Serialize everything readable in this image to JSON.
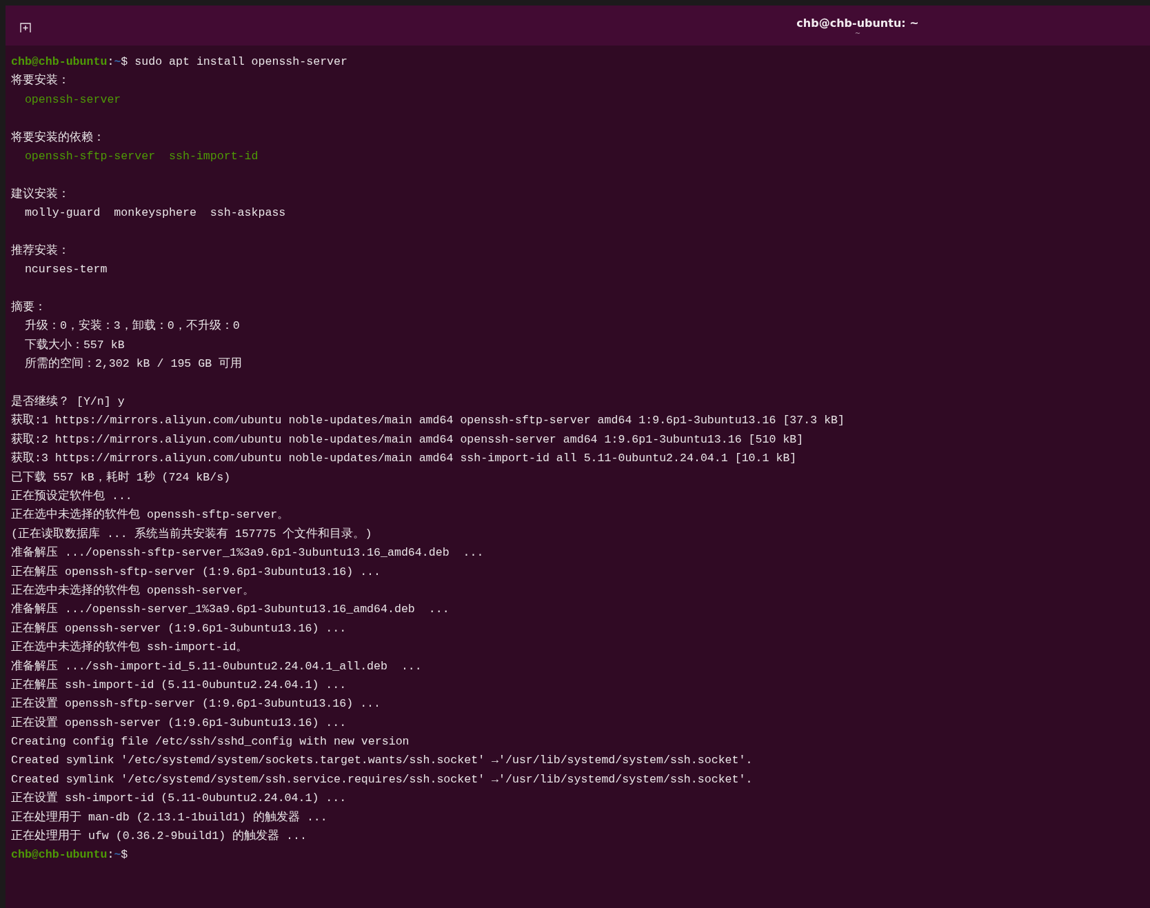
{
  "window": {
    "title": "chb@chb-ubuntu: ~",
    "subtitle": "~"
  },
  "lines": [
    {
      "kind": "text",
      "segments": [
        {
          "kind": "user",
          "text": "chb@chb-ubuntu"
        },
        {
          "kind": "plain",
          "text": ":"
        },
        {
          "kind": "path",
          "text": "~"
        },
        {
          "kind": "plain",
          "text": "$ sudo apt install openssh-server"
        }
      ]
    },
    {
      "kind": "text",
      "segments": [
        {
          "kind": "plain",
          "text": "将要安装："
        }
      ]
    },
    {
      "kind": "text",
      "segments": [
        {
          "kind": "package",
          "text": "  openssh-server"
        }
      ]
    },
    {
      "kind": "blank"
    },
    {
      "kind": "text",
      "segments": [
        {
          "kind": "plain",
          "text": "将要安装的依赖："
        }
      ]
    },
    {
      "kind": "text",
      "segments": [
        {
          "kind": "package",
          "text": "  openssh-sftp-server  ssh-import-id"
        }
      ]
    },
    {
      "kind": "blank"
    },
    {
      "kind": "text",
      "segments": [
        {
          "kind": "plain",
          "text": "建议安装："
        }
      ]
    },
    {
      "kind": "text",
      "segments": [
        {
          "kind": "plain",
          "text": "  molly-guard  monkeysphere  ssh-askpass"
        }
      ]
    },
    {
      "kind": "blank"
    },
    {
      "kind": "text",
      "segments": [
        {
          "kind": "plain",
          "text": "推荐安装："
        }
      ]
    },
    {
      "kind": "text",
      "segments": [
        {
          "kind": "plain",
          "text": "  ncurses-term"
        }
      ]
    },
    {
      "kind": "blank"
    },
    {
      "kind": "text",
      "segments": [
        {
          "kind": "plain",
          "text": "摘要："
        }
      ]
    },
    {
      "kind": "text",
      "segments": [
        {
          "kind": "plain",
          "text": "  升级：0，安装：3，卸载：0，不升级：0"
        }
      ]
    },
    {
      "kind": "text",
      "segments": [
        {
          "kind": "plain",
          "text": "  下载大小：557 kB"
        }
      ]
    },
    {
      "kind": "text",
      "segments": [
        {
          "kind": "plain",
          "text": "  所需的空间：2,302 kB / 195 GB 可用"
        }
      ]
    },
    {
      "kind": "blank"
    },
    {
      "kind": "text",
      "segments": [
        {
          "kind": "plain",
          "text": "是否继续？ [Y/n] y"
        }
      ]
    },
    {
      "kind": "text",
      "segments": [
        {
          "kind": "plain",
          "text": "获取:1 https://mirrors.aliyun.com/ubuntu noble-updates/main amd64 openssh-sftp-server amd64 1:9.6p1-3ubuntu13.16 [37.3 kB]"
        }
      ]
    },
    {
      "kind": "text",
      "segments": [
        {
          "kind": "plain",
          "text": "获取:2 https://mirrors.aliyun.com/ubuntu noble-updates/main amd64 openssh-server amd64 1:9.6p1-3ubuntu13.16 [510 kB]"
        }
      ]
    },
    {
      "kind": "text",
      "segments": [
        {
          "kind": "plain",
          "text": "获取:3 https://mirrors.aliyun.com/ubuntu noble-updates/main amd64 ssh-import-id all 5.11-0ubuntu2.24.04.1 [10.1 kB]"
        }
      ]
    },
    {
      "kind": "text",
      "segments": [
        {
          "kind": "plain",
          "text": "已下载 557 kB，耗时 1秒 (724 kB/s)"
        }
      ]
    },
    {
      "kind": "text",
      "segments": [
        {
          "kind": "plain",
          "text": "正在预设定软件包 ..."
        }
      ]
    },
    {
      "kind": "text",
      "segments": [
        {
          "kind": "plain",
          "text": "正在选中未选择的软件包 openssh-sftp-server。"
        }
      ]
    },
    {
      "kind": "text",
      "segments": [
        {
          "kind": "plain",
          "text": "(正在读取数据库 ... 系统当前共安装有 157775 个文件和目录。)"
        }
      ]
    },
    {
      "kind": "text",
      "segments": [
        {
          "kind": "plain",
          "text": "准备解压 .../openssh-sftp-server_1%3a9.6p1-3ubuntu13.16_amd64.deb  ..."
        }
      ]
    },
    {
      "kind": "text",
      "segments": [
        {
          "kind": "plain",
          "text": "正在解压 openssh-sftp-server (1:9.6p1-3ubuntu13.16) ..."
        }
      ]
    },
    {
      "kind": "text",
      "segments": [
        {
          "kind": "plain",
          "text": "正在选中未选择的软件包 openssh-server。"
        }
      ]
    },
    {
      "kind": "text",
      "segments": [
        {
          "kind": "plain",
          "text": "准备解压 .../openssh-server_1%3a9.6p1-3ubuntu13.16_amd64.deb  ..."
        }
      ]
    },
    {
      "kind": "text",
      "segments": [
        {
          "kind": "plain",
          "text": "正在解压 openssh-server (1:9.6p1-3ubuntu13.16) ..."
        }
      ]
    },
    {
      "kind": "text",
      "segments": [
        {
          "kind": "plain",
          "text": "正在选中未选择的软件包 ssh-import-id。"
        }
      ]
    },
    {
      "kind": "text",
      "segments": [
        {
          "kind": "plain",
          "text": "准备解压 .../ssh-import-id_5.11-0ubuntu2.24.04.1_all.deb  ..."
        }
      ]
    },
    {
      "kind": "text",
      "segments": [
        {
          "kind": "plain",
          "text": "正在解压 ssh-import-id (5.11-0ubuntu2.24.04.1) ..."
        }
      ]
    },
    {
      "kind": "text",
      "segments": [
        {
          "kind": "plain",
          "text": "正在设置 openssh-sftp-server (1:9.6p1-3ubuntu13.16) ..."
        }
      ]
    },
    {
      "kind": "text",
      "segments": [
        {
          "kind": "plain",
          "text": "正在设置 openssh-server (1:9.6p1-3ubuntu13.16) ..."
        }
      ]
    },
    {
      "kind": "text",
      "segments": [
        {
          "kind": "plain",
          "text": "Creating config file /etc/ssh/sshd_config with new version"
        }
      ]
    },
    {
      "kind": "text",
      "segments": [
        {
          "kind": "plain",
          "text": "Created symlink '/etc/systemd/system/sockets.target.wants/ssh.socket' →'/usr/lib/systemd/system/ssh.socket'."
        }
      ]
    },
    {
      "kind": "text",
      "segments": [
        {
          "kind": "plain",
          "text": "Created symlink '/etc/systemd/system/ssh.service.requires/ssh.socket' →'/usr/lib/systemd/system/ssh.socket'."
        }
      ]
    },
    {
      "kind": "text",
      "segments": [
        {
          "kind": "plain",
          "text": "正在设置 ssh-import-id (5.11-0ubuntu2.24.04.1) ..."
        }
      ]
    },
    {
      "kind": "text",
      "segments": [
        {
          "kind": "plain",
          "text": "正在处理用于 man-db (2.13.1-1build1) 的触发器 ..."
        }
      ]
    },
    {
      "kind": "text",
      "segments": [
        {
          "kind": "plain",
          "text": "正在处理用于 ufw (0.36.2-9build1) 的触发器 ..."
        }
      ]
    },
    {
      "kind": "text",
      "segments": [
        {
          "kind": "user",
          "text": "chb@chb-ubuntu"
        },
        {
          "kind": "plain",
          "text": ":"
        },
        {
          "kind": "path",
          "text": "~"
        },
        {
          "kind": "plain",
          "text": "$"
        }
      ]
    }
  ]
}
